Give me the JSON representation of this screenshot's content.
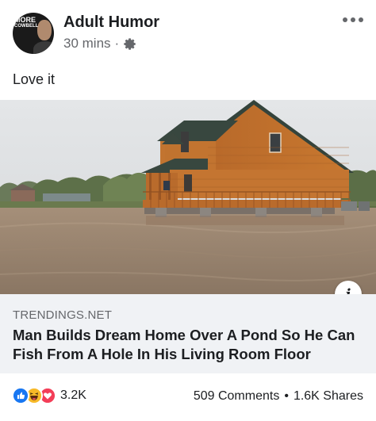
{
  "post": {
    "page_name": "Adult Humor",
    "timestamp": "30 mins",
    "separator": "·",
    "privacy_icon": "gear-icon",
    "caption": "Love it",
    "avatar_text_line1": "MORE",
    "avatar_text_line2": "COWBELL"
  },
  "link_preview": {
    "domain": "TRENDINGS.NET",
    "title": "Man Builds Dream Home Over A Pond So He Can Fish From A Hole In His Living Room Floor",
    "info_label": "i"
  },
  "footer": {
    "reaction_icons": [
      "like-icon",
      "haha-icon",
      "love-icon"
    ],
    "reaction_count": "3.2K",
    "comments": "509 Comments",
    "dot": "•",
    "shares": "1.6K Shares"
  },
  "colors": {
    "like": "#1877f2",
    "haha": "#f7b928",
    "love": "#f33e58",
    "secondary_text": "#65676b",
    "link_box_bg": "#f0f2f5"
  }
}
